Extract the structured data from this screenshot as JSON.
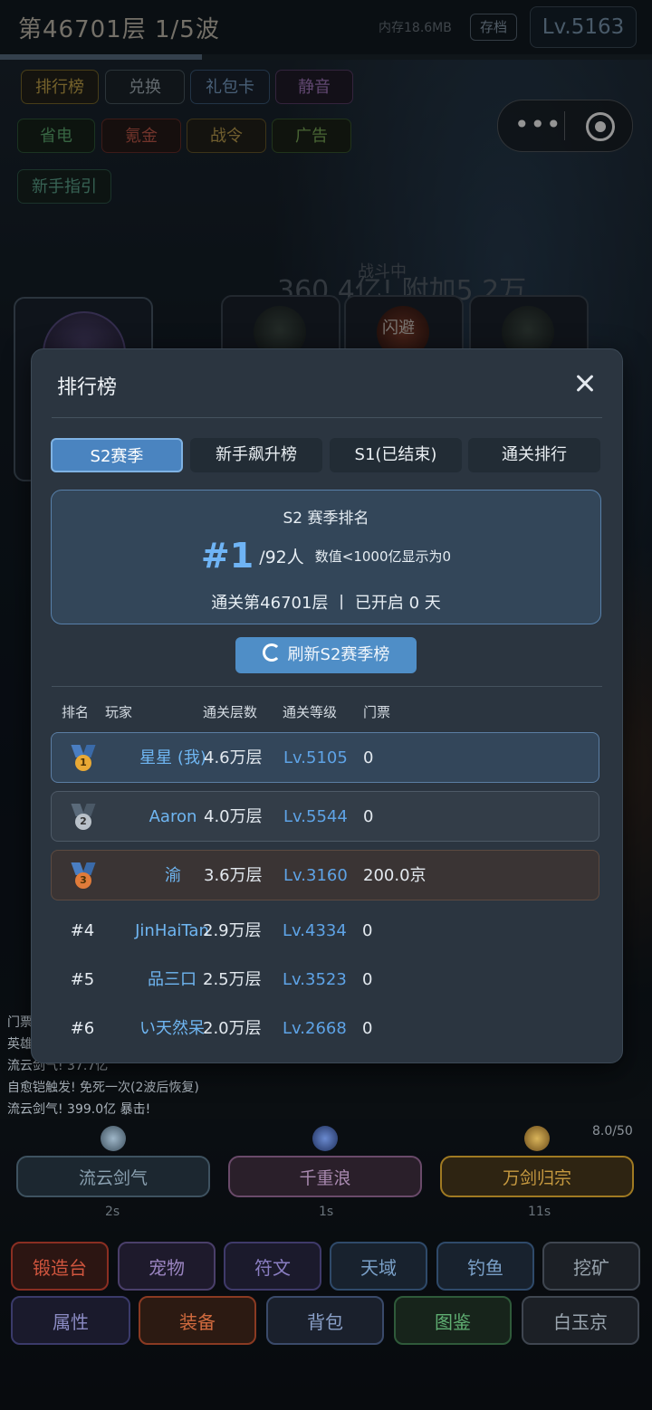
{
  "topbar": {
    "title": "第46701层  1/5波",
    "memory": "内存18.6MB",
    "save_label": "存档",
    "level": "Lv.5163",
    "wave_progress": 0.31
  },
  "toolbar": {
    "row1": [
      "排行榜",
      "兑换",
      "礼包卡",
      "静音"
    ],
    "row2": [
      "省电",
      "氪金",
      "战令",
      "广告"
    ],
    "row3": [
      "新手指引"
    ]
  },
  "battle": {
    "state": "战斗中",
    "damage_text": "360.4亿! 附加5.2万",
    "enemy_label": "闪避"
  },
  "log": [
    "门票",
    "英雄",
    "流云剑气! 37.7亿",
    "自愈铠触发! 免死一次(2波后恢复)",
    "流云剑气! 399.0亿 暴击!"
  ],
  "skills": [
    {
      "name": "流云剑气",
      "cooldown": "2s",
      "icon": "sword-energy-icon"
    },
    {
      "name": "千重浪",
      "cooldown": "1s",
      "icon": "wave-icon"
    },
    {
      "name": "万剑归宗",
      "cooldown": "11s",
      "icon": "sun-icon"
    }
  ],
  "skill_count": "8.0/50",
  "bottom_nav": {
    "row1": [
      "锻造台",
      "宠物",
      "符文",
      "天域",
      "钓鱼",
      "挖矿"
    ],
    "row2": [
      "属性",
      "装备",
      "背包",
      "图鉴",
      "白玉京"
    ]
  },
  "modal": {
    "title": "排行榜",
    "tabs": [
      "S2赛季",
      "新手飙升榜",
      "S1(已结束)",
      "通关排行"
    ],
    "active_tab": 0,
    "summary": {
      "title": "S2 赛季排名",
      "rank": "#1",
      "total": "/92人",
      "note": "数值<1000亿显示为0",
      "bottom": "通关第46701层 丨 已开启 0 天"
    },
    "refresh_label": "刷新S2赛季榜",
    "columns": [
      "排名",
      "玩家",
      "通关层数",
      "通关等级",
      "门票"
    ],
    "rows": [
      {
        "rank": "1",
        "player": "星星 (我)",
        "floor": "4.6万层",
        "level": "Lv.5105",
        "ticket": "0"
      },
      {
        "rank": "2",
        "player": "Aaron",
        "floor": "4.0万层",
        "level": "Lv.5544",
        "ticket": "0"
      },
      {
        "rank": "3",
        "player": "渝",
        "floor": "3.6万层",
        "level": "Lv.3160",
        "ticket": "200.0京"
      },
      {
        "rank": "#4",
        "player": "JinHaiTan",
        "floor": "2.9万层",
        "level": "Lv.4334",
        "ticket": "0"
      },
      {
        "rank": "#5",
        "player": "品三口",
        "floor": "2.5万层",
        "level": "Lv.3523",
        "ticket": "0"
      },
      {
        "rank": "#6",
        "player": "い天然呆",
        "floor": "2.0万层",
        "level": "Lv.2668",
        "ticket": "0"
      }
    ]
  },
  "colors": {
    "accent": "#4a84c0",
    "gold": "#e9a935",
    "silver": "#b9c1c9",
    "bronze": "#e07b3a"
  }
}
